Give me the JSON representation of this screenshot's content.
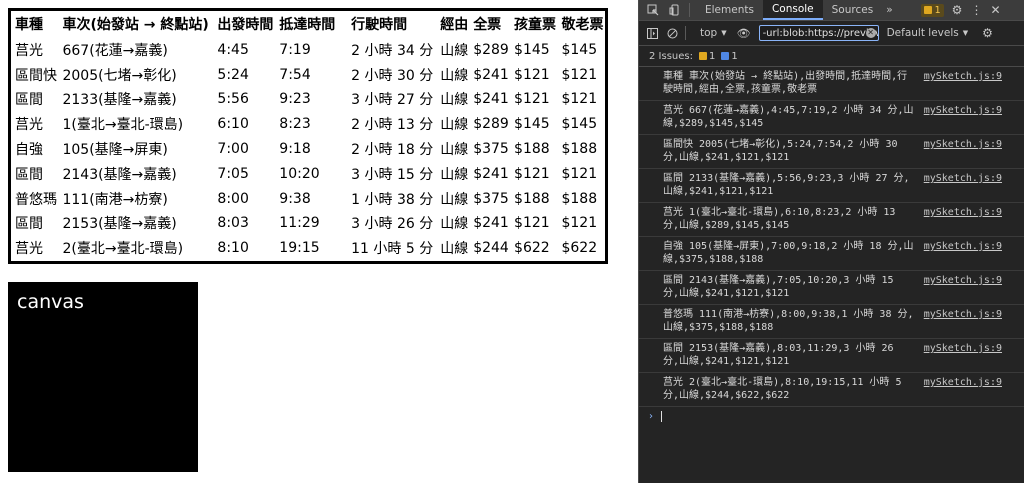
{
  "table": {
    "headers": [
      "車種",
      "車次(始發站 → 終點站)",
      "出發時間",
      "抵達時間",
      "行駛時間",
      "經由",
      "全票",
      "孩童票",
      "敬老票"
    ],
    "rows": [
      [
        "莒光",
        "667(花蓮→嘉義)",
        "4:45",
        "7:19",
        "2 小時 34 分",
        "山線",
        "$289",
        "$145",
        "$145"
      ],
      [
        "區間快",
        "2005(七堵→彰化)",
        "5:24",
        "7:54",
        "2 小時 30 分",
        "山線",
        "$241",
        "$121",
        "$121"
      ],
      [
        "區間",
        "2133(基隆→嘉義)",
        "5:56",
        "9:23",
        "3 小時 27 分",
        "山線",
        "$241",
        "$121",
        "$121"
      ],
      [
        "莒光",
        "1(臺北→臺北-環島)",
        "6:10",
        "8:23",
        "2 小時 13 分",
        "山線",
        "$289",
        "$145",
        "$145"
      ],
      [
        "自強",
        "105(基隆→屏東)",
        "7:00",
        "9:18",
        "2 小時 18 分",
        "山線",
        "$375",
        "$188",
        "$188"
      ],
      [
        "區間",
        "2143(基隆→嘉義)",
        "7:05",
        "10:20",
        "3 小時 15 分",
        "山線",
        "$241",
        "$121",
        "$121"
      ],
      [
        "普悠瑪",
        "111(南港→枋寮)",
        "8:00",
        "9:38",
        "1 小時 38 分",
        "山線",
        "$375",
        "$188",
        "$188"
      ],
      [
        "區間",
        "2153(基隆→嘉義)",
        "8:03",
        "11:29",
        "3 小時 26 分",
        "山線",
        "$241",
        "$121",
        "$121"
      ],
      [
        "莒光",
        "2(臺北→臺北-環島)",
        "8:10",
        "19:15",
        "11 小時 5 分",
        "山線",
        "$244",
        "$622",
        "$622"
      ]
    ]
  },
  "canvas": {
    "label": "canvas"
  },
  "devtools": {
    "tabs": [
      "Elements",
      "Console",
      "Sources"
    ],
    "active_tab": "Console",
    "more": "»",
    "issue_count": "1",
    "toolbar": {
      "context": "top",
      "filter_value": "-url:blob:https://previev",
      "levels": "Default levels"
    },
    "issues": {
      "label": "2 Issues:",
      "warn": "1",
      "info": "1"
    },
    "logs": [
      {
        "text": "車種 車次(始發站 → 終點站),出發時間,抵達時間,行駛時間,經由,全票,孩童票,敬老票",
        "src": "mySketch.js:9"
      },
      {
        "text": "莒光 667(花蓮→嘉義),4:45,7:19,2 小時 34 分,山線,$289,$145,$145",
        "src": "mySketch.js:9"
      },
      {
        "text": "區間快 2005(七堵→彰化),5:24,7:54,2 小時 30 分,山線,$241,$121,$121",
        "src": "mySketch.js:9"
      },
      {
        "text": "區間 2133(基隆→嘉義),5:56,9:23,3 小時 27 分,山線,$241,$121,$121",
        "src": "mySketch.js:9"
      },
      {
        "text": "莒光 1(臺北→臺北-環島),6:10,8:23,2 小時 13 分,山線,$289,$145,$145",
        "src": "mySketch.js:9"
      },
      {
        "text": "自強 105(基隆→屏東),7:00,9:18,2 小時 18 分,山線,$375,$188,$188",
        "src": "mySketch.js:9"
      },
      {
        "text": "區間 2143(基隆→嘉義),7:05,10:20,3 小時 15 分,山線,$241,$121,$121",
        "src": "mySketch.js:9"
      },
      {
        "text": "普悠瑪 111(南港→枋寮),8:00,9:38,1 小時 38 分,山線,$375,$188,$188",
        "src": "mySketch.js:9"
      },
      {
        "text": "區間 2153(基隆→嘉義),8:03,11:29,3 小時 26 分,山線,$241,$121,$121",
        "src": "mySketch.js:9"
      },
      {
        "text": "莒光 2(臺北→臺北-環島),8:10,19:15,11 小時 5 分,山線,$244,$622,$622",
        "src": "mySketch.js:9"
      }
    ]
  }
}
